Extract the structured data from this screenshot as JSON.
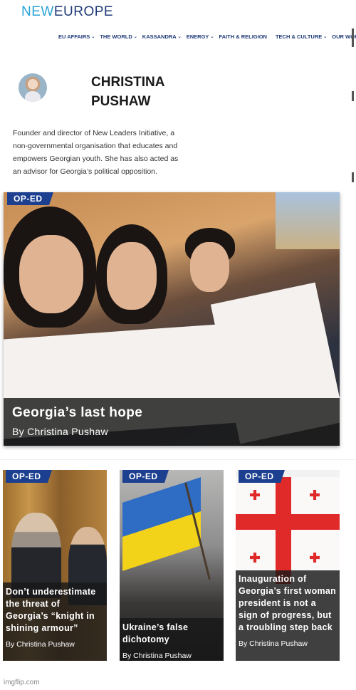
{
  "site": {
    "logo_part1": "NEW",
    "logo_part2": "EUROPE"
  },
  "nav": [
    {
      "label": "EU AFFAIRS",
      "chevron": true
    },
    {
      "label": "THE WORLD",
      "chevron": true
    },
    {
      "label": "KASSANDRA",
      "chevron": true
    },
    {
      "label": "ENERGY",
      "chevron": true
    },
    {
      "label": "FAITH & RELIGION",
      "chevron": false
    },
    {
      "label": "TECH & CULTURE",
      "chevron": true
    },
    {
      "label": "OUR WORLD",
      "chevron": false
    }
  ],
  "author": {
    "name": "CHRISTINA PUSHAW",
    "bio": "Founder and director of New Leaders Initiative, a non-governmental organisation that educates and empowers Georgian youth. She has also acted as an advisor for Georgia’s political opposition."
  },
  "featured": {
    "badge": "OP-ED",
    "title": "Georgia’s last hope",
    "byline": "By Christina Pushaw"
  },
  "articles": [
    {
      "badge": "OP-ED",
      "title": "Don’t underestimate the threat of Georgia’s “knight in shining armour”",
      "byline": "By Christina Pushaw"
    },
    {
      "badge": "OP-ED",
      "title": "Ukraine’s false dichotomy",
      "byline": "By Christina Pushaw"
    },
    {
      "badge": "OP-ED",
      "title": "Inauguration of Georgia’s first woman president is not a sign of progress, but a troubling step back",
      "byline": "By Christina Pushaw"
    }
  ],
  "footer": {
    "watermark": "imgflip.com"
  },
  "colors": {
    "brand_light": "#2ba3d6",
    "brand_dark": "#1e3a78",
    "badge": "#1c3f8f"
  }
}
